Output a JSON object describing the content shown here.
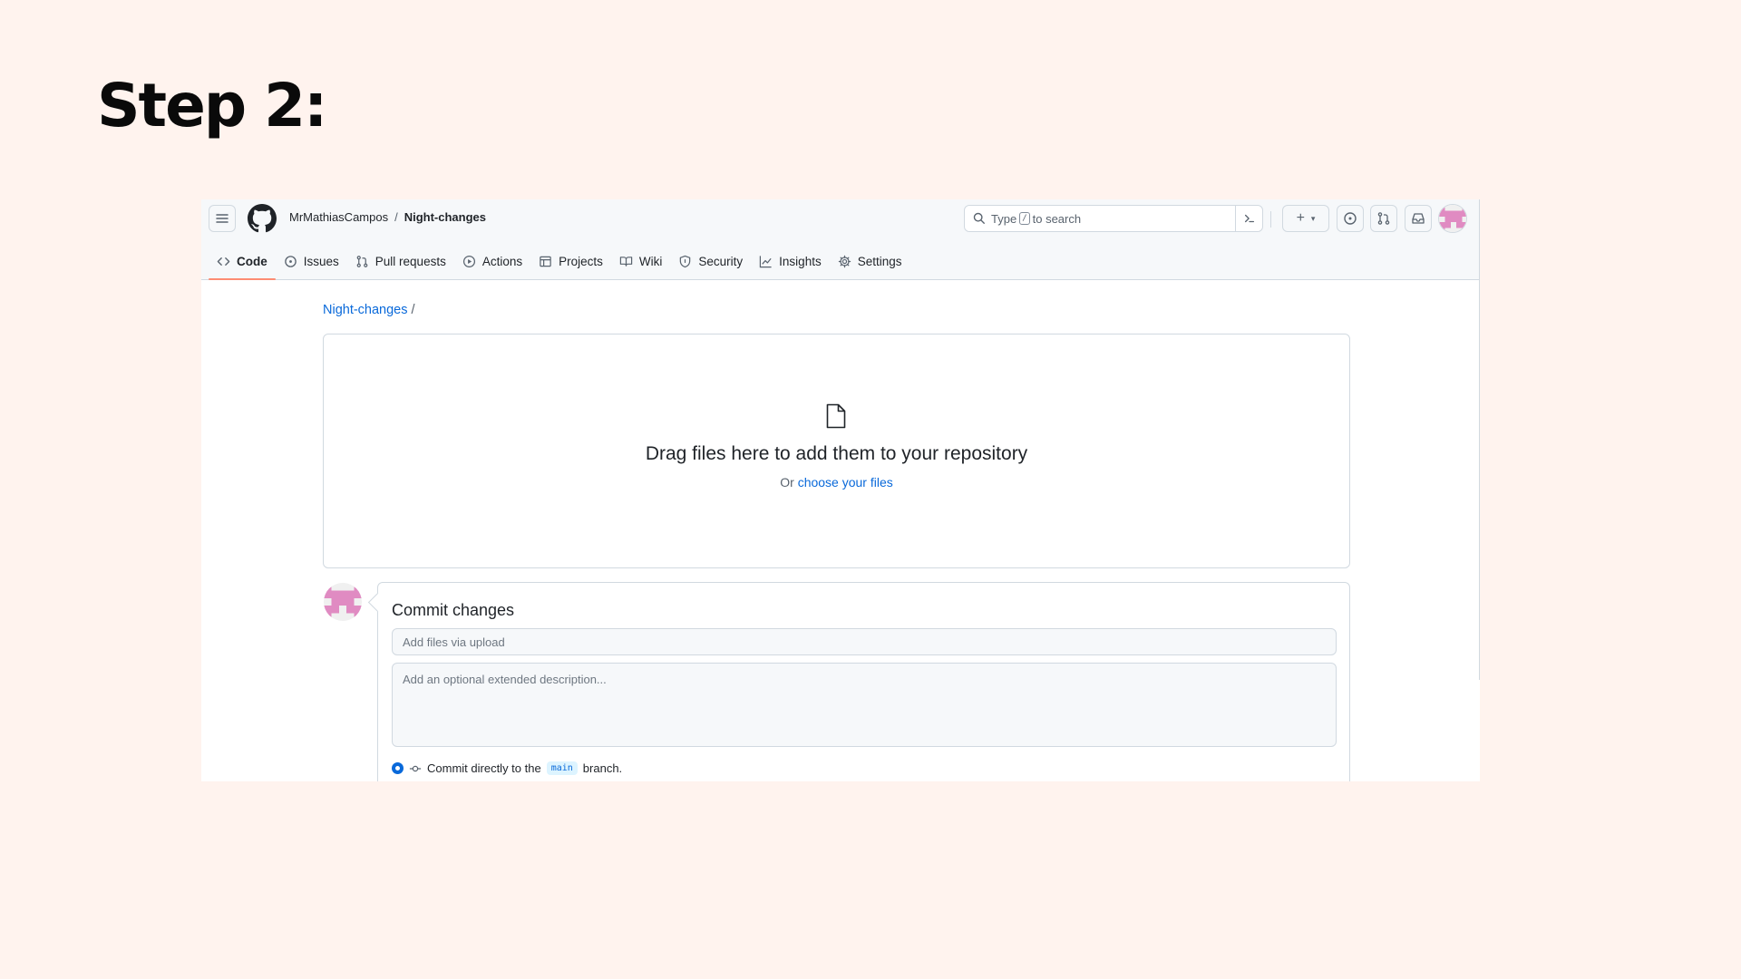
{
  "slide": {
    "title": "Step 2:"
  },
  "header": {
    "owner": "MrMathiasCampos",
    "separator": "/",
    "repo": "Night-changes",
    "search": {
      "prefix": "Type",
      "key": "/",
      "suffix": "to search"
    },
    "plus_label": "+"
  },
  "tabs": [
    {
      "label": "Code",
      "icon": "code-icon",
      "active": true
    },
    {
      "label": "Issues",
      "icon": "issue-opened-icon"
    },
    {
      "label": "Pull requests",
      "icon": "git-pull-request-icon"
    },
    {
      "label": "Actions",
      "icon": "play-icon"
    },
    {
      "label": "Projects",
      "icon": "table-icon"
    },
    {
      "label": "Wiki",
      "icon": "book-icon"
    },
    {
      "label": "Security",
      "icon": "shield-icon"
    },
    {
      "label": "Insights",
      "icon": "graph-icon"
    },
    {
      "label": "Settings",
      "icon": "gear-icon"
    }
  ],
  "path": {
    "repo_link": "Night-changes",
    "slash": "/"
  },
  "dropzone": {
    "title": "Drag files here to add them to your repository",
    "or_text": "Or",
    "choose_link": "choose your files"
  },
  "commit": {
    "title": "Commit changes",
    "summary_placeholder": "Add files via upload",
    "description_placeholder": "Add an optional extended description...",
    "branch_prefix": "Commit directly to the",
    "branch_name": "main",
    "branch_suffix": "branch."
  },
  "colors": {
    "accent": "#0969da",
    "tab_underline": "#fd8c73",
    "slide_bg": "#fff3ee"
  }
}
